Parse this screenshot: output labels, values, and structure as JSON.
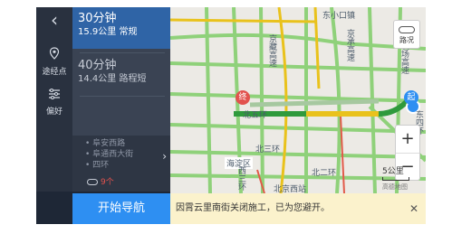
{
  "rail": {
    "back_glyph": "‹",
    "waypoint_label": "途经点",
    "prefs_label": "偏好"
  },
  "routes": [
    {
      "time": "30分钟",
      "detail": "15.9公里 常规"
    },
    {
      "time": "40分钟",
      "detail": "14.4公里 路程短"
    }
  ],
  "roads": {
    "items": [
      "阜安西路",
      "阜通西大街",
      "四环"
    ],
    "count_label": "9个",
    "chevron": "›"
  },
  "start_button": "开始导航",
  "map": {
    "labels": {
      "top_road": "东小口镇",
      "jing_cheng": "京承高速",
      "jing_zang": "京藏高速",
      "bei_wuhuan": "北五环",
      "bei_sanhuan": "北三环",
      "bei_erhuan": "北二环",
      "haidian": "海淀区",
      "xi_sanhuan": "西三环",
      "dongsihuan": "东四环",
      "airport": "机场高速",
      "beijing_station": "北京西站"
    },
    "markers": {
      "start": "起",
      "end": "终"
    },
    "traffic_label": "路况",
    "zoom_in": "+",
    "zoom_out": "−",
    "scale": "5公里",
    "logo": "高德地图",
    "colors": {
      "route": "#2f9a3c",
      "congested": "#e9c21c",
      "road": "#7ed36b"
    }
  },
  "notice": {
    "text": "因霄云里南街关闭施工，已为您避开。",
    "close": "✕"
  }
}
